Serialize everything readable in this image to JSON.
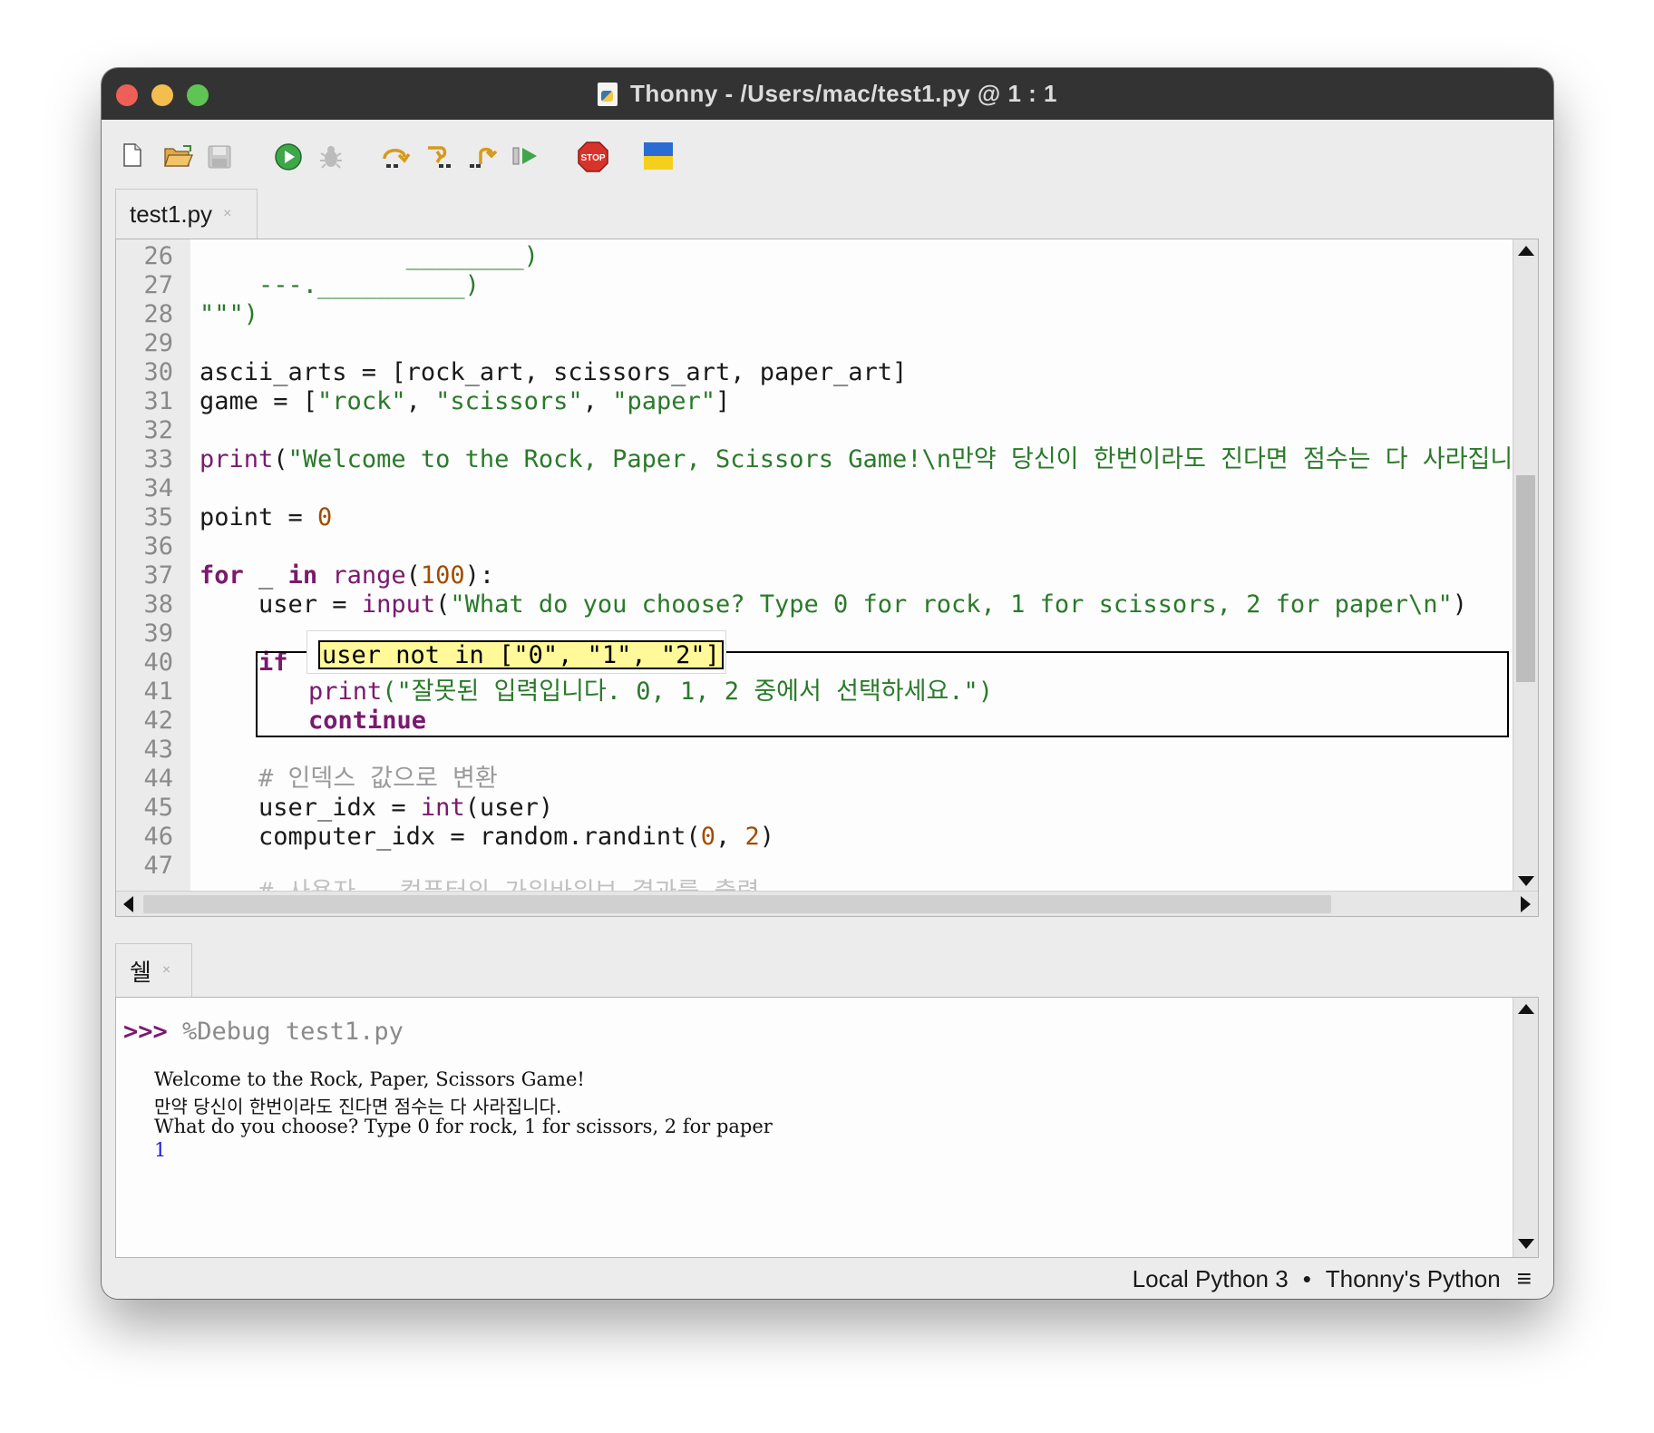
{
  "window": {
    "title": "Thonny  -  /Users/mac/test1.py  @  1 : 1"
  },
  "toolbar": {
    "buttons": [
      "new-file",
      "open-file",
      "save-file",
      "run",
      "debug",
      "step-over",
      "step-into",
      "step-out",
      "resume",
      "stop",
      "ukraine-flag"
    ],
    "stop_label": "STOP"
  },
  "editor": {
    "tab_label": "test1.py",
    "tab_close": "×",
    "line_numbers": [
      "26",
      "27",
      "28",
      "29",
      "30",
      "31",
      "32",
      "33",
      "34",
      "35",
      "36",
      "37",
      "38",
      "39",
      "40",
      "41",
      "42",
      "43",
      "44",
      "45",
      "46",
      "47"
    ],
    "lines": {
      "l26": "              ________)",
      "l27": "    ---.__________)",
      "l28": "\"\"\")",
      "l30": "ascii_arts = [rock_art, scissors_art, paper_art]",
      "l31a": "game = [",
      "l31b": "\"rock\"",
      "l31c": ", ",
      "l31d": "\"scissors\"",
      "l31e": ", ",
      "l31f": "\"paper\"",
      "l31g": "]",
      "l33a": "print",
      "l33b": "(",
      "l33c": "\"Welcome to the Rock, Paper, Scissors Game!\\n만약 당신이 한번이라도 진다면 점수는 다 사라집니다.",
      "l35a": "point = ",
      "l35b": "0",
      "l37a": "for",
      "l37b": " _ ",
      "l37c": "in",
      "l37d": " ",
      "l37e": "range",
      "l37f": "(",
      "l37g": "100",
      "l37h": "):",
      "l38a": "    user = ",
      "l38b": "input",
      "l38c": "(",
      "l38d": "\"What do you choose? Type 0 for rock, 1 for scissors, 2 for paper\\n\"",
      "l38e": ")",
      "l40": "if",
      "l41a": "print",
      "l41b": "(\"잘못된 입력입니다. 0, 1, 2 중에서 선택하세요.\")",
      "l42": "continue",
      "l44": "# 인덱스 값으로 변환",
      "l45a": "    user_idx = ",
      "l45b": "int",
      "l45c": "(user)",
      "l46a": "    computer_idx = random.randint(",
      "l46b": "0",
      "l46c": ", ",
      "l46d": "2",
      "l46e": ")",
      "l48": "# 사용자 - 컴퓨터의 가위바위보 결과를 출력"
    },
    "tooltip": "user not in [\"0\", \"1\", \"2\"]"
  },
  "shell": {
    "tab_label": "쉘",
    "tab_close": "×",
    "prompt": ">>>",
    "command": " %Debug test1.py",
    "output": [
      "Welcome to the Rock, Paper, Scissors Game!",
      "만약 당신이 한번이라도 진다면 점수는 다 사라집니다.",
      "What do you choose? Type 0 for rock, 1 for scissors, 2 for paper"
    ],
    "user_input": "1"
  },
  "statusbar": {
    "interpreter": "Local Python 3",
    "separator": "•",
    "python": "Thonny's Python",
    "menu_glyph": "≡"
  },
  "colors": {
    "keyword": "#7a1a6e",
    "string": "#2a7a2a",
    "number": "#a04d00",
    "comment": "#9a9a9a",
    "tooltip_bg": "#fff99a",
    "input_blue": "#1a1adc"
  }
}
